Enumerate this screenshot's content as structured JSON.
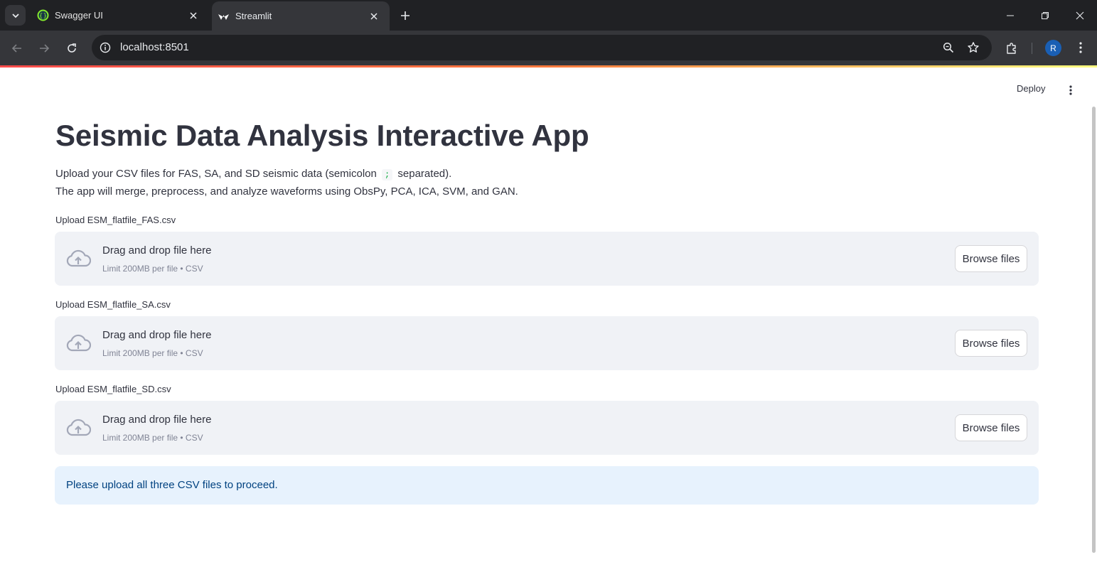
{
  "browser": {
    "tabs": [
      {
        "title": "Swagger UI"
      },
      {
        "title": "Streamlit"
      }
    ],
    "url": "localhost:8501",
    "profile_initial": "R"
  },
  "app": {
    "deploy_label": "Deploy",
    "title": "Seismic Data Analysis Interactive App",
    "description": {
      "line1_before": "Upload your CSV files for FAS, SA, and SD seismic data (semicolon",
      "line1_code": ";",
      "line1_after": "separated).",
      "line2": "The app will merge, preprocess, and analyze waveforms using ObsPy, PCA, ICA, SVM, and GAN."
    },
    "uploaders": [
      {
        "label": "Upload ESM_flatfile_FAS.csv",
        "drop_text": "Drag and drop file here",
        "limit_text": "Limit 200MB per file • CSV",
        "button": "Browse files"
      },
      {
        "label": "Upload ESM_flatfile_SA.csv",
        "drop_text": "Drag and drop file here",
        "limit_text": "Limit 200MB per file • CSV",
        "button": "Browse files"
      },
      {
        "label": "Upload ESM_flatfile_SD.csv",
        "drop_text": "Drag and drop file here",
        "limit_text": "Limit 200MB per file • CSV",
        "button": "Browse files"
      }
    ],
    "info_message": "Please upload all three CSV files to proceed."
  },
  "colors": {
    "chrome_dark": "#202124",
    "chrome_toolbar": "#35363a",
    "text_primary": "#31333f",
    "dropzone_bg": "#f0f2f6",
    "info_bg": "#e7f2fd",
    "info_text": "#004280",
    "accent_red": "#ff4b4b"
  }
}
